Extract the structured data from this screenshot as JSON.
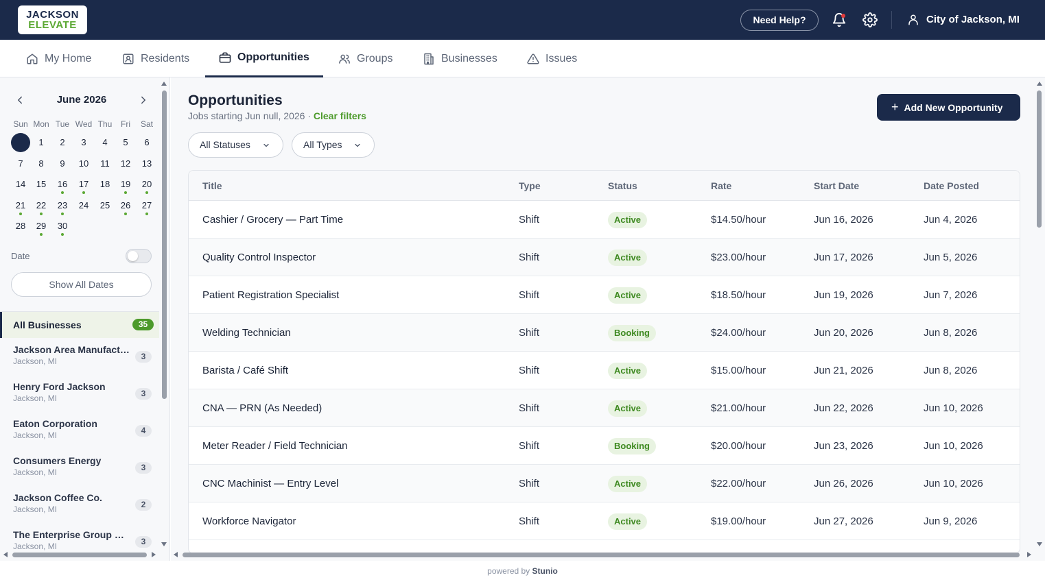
{
  "header": {
    "logo_line1": "JACKSON",
    "logo_line2": "ELEVATE",
    "help_label": "Need Help?",
    "account_name": "City of Jackson, MI"
  },
  "nav": {
    "tabs": [
      {
        "label": "My Home",
        "icon": "home-icon"
      },
      {
        "label": "Residents",
        "icon": "id-card-icon"
      },
      {
        "label": "Opportunities",
        "icon": "briefcase-icon",
        "active": true
      },
      {
        "label": "Groups",
        "icon": "users-icon"
      },
      {
        "label": "Businesses",
        "icon": "building-icon"
      },
      {
        "label": "Issues",
        "icon": "warning-icon"
      }
    ]
  },
  "calendar": {
    "month_label": "June 2026",
    "weekdays": [
      "Sun",
      "Mon",
      "Tue",
      "Wed",
      "Thu",
      "Fri",
      "Sat"
    ],
    "days": [
      "",
      "1",
      "2",
      "3",
      "4",
      "5",
      "6",
      "7",
      "8",
      "9",
      "10",
      "11",
      "12",
      "13",
      "14",
      "15",
      "16",
      "17",
      "18",
      "19",
      "20",
      "21",
      "22",
      "23",
      "24",
      "25",
      "26",
      "27",
      "28",
      "29",
      "30"
    ],
    "days_with_events": [
      "16",
      "17",
      "19",
      "20",
      "21",
      "22",
      "23",
      "26",
      "27",
      "29",
      "30"
    ],
    "date_toggle_label": "Date",
    "date_toggle_on": false,
    "show_all_label": "Show All Dates"
  },
  "businesses": [
    {
      "name": "All Businesses",
      "location": "",
      "count": "35",
      "selected": true
    },
    {
      "name": "Jackson Area Manufacturers Association",
      "location": "Jackson, MI",
      "count": "3"
    },
    {
      "name": "Henry Ford Jackson",
      "location": "Jackson, MI",
      "count": "3"
    },
    {
      "name": "Eaton Corporation",
      "location": "Jackson, MI",
      "count": "4"
    },
    {
      "name": "Consumers Energy",
      "location": "Jackson, MI",
      "count": "3"
    },
    {
      "name": "Jackson Coffee Co.",
      "location": "Jackson, MI",
      "count": "2"
    },
    {
      "name": "The Enterprise Group of Jackson",
      "location": "Jackson, MI",
      "count": "3"
    }
  ],
  "main": {
    "title": "Opportunities",
    "subtitle": "Jobs starting Jun null, 2026 · ",
    "clear_filters": "Clear filters",
    "add_button": "Add New Opportunity",
    "filters": [
      {
        "label": "All Statuses"
      },
      {
        "label": "All Types"
      }
    ],
    "table": {
      "columns": [
        "Title",
        "Type",
        "Status",
        "Rate",
        "Start Date",
        "Date Posted"
      ],
      "rows": [
        {
          "title": "Cashier / Grocery — Part Time",
          "type": "Shift",
          "status": "Active",
          "rate": "$14.50/hour",
          "start": "Jun 16, 2026",
          "posted": "Jun 4, 2026"
        },
        {
          "title": "Quality Control Inspector",
          "type": "Shift",
          "status": "Active",
          "rate": "$23.00/hour",
          "start": "Jun 17, 2026",
          "posted": "Jun 5, 2026"
        },
        {
          "title": "Patient Registration Specialist",
          "type": "Shift",
          "status": "Active",
          "rate": "$18.50/hour",
          "start": "Jun 19, 2026",
          "posted": "Jun 7, 2026"
        },
        {
          "title": "Welding Technician",
          "type": "Shift",
          "status": "Booking",
          "rate": "$24.00/hour",
          "start": "Jun 20, 2026",
          "posted": "Jun 8, 2026"
        },
        {
          "title": "Barista / Café Shift",
          "type": "Shift",
          "status": "Active",
          "rate": "$15.00/hour",
          "start": "Jun 21, 2026",
          "posted": "Jun 8, 2026"
        },
        {
          "title": "CNA — PRN (As Needed)",
          "type": "Shift",
          "status": "Active",
          "rate": "$21.00/hour",
          "start": "Jun 22, 2026",
          "posted": "Jun 10, 2026"
        },
        {
          "title": "Meter Reader / Field Technician",
          "type": "Shift",
          "status": "Booking",
          "rate": "$20.00/hour",
          "start": "Jun 23, 2026",
          "posted": "Jun 10, 2026"
        },
        {
          "title": "CNC Machinist — Entry Level",
          "type": "Shift",
          "status": "Active",
          "rate": "$22.00/hour",
          "start": "Jun 26, 2026",
          "posted": "Jun 10, 2026"
        },
        {
          "title": "Workforce Navigator",
          "type": "Shift",
          "status": "Active",
          "rate": "$19.00/hour",
          "start": "Jun 27, 2026",
          "posted": "Jun 9, 2026"
        }
      ]
    }
  },
  "footer": {
    "prefix": "powered by",
    "brand": "Stunio"
  },
  "colors": {
    "navy": "#1b2a4a",
    "green": "#4c9a2a",
    "alert": "#e23b3b"
  }
}
